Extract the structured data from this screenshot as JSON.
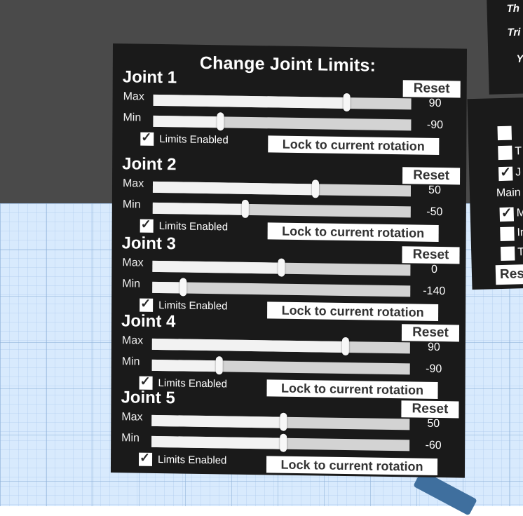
{
  "panel": {
    "title": "Change Joint Limits:",
    "reset_label": "Reset",
    "max_label": "Max",
    "min_label": "Min",
    "limits_label": "Limits Enabled",
    "lock_label": "Lock to current rotation"
  },
  "joints": [
    {
      "name": "Joint 1",
      "max": "90",
      "min": "-90",
      "max_pos": 0.75,
      "min_pos": 0.26,
      "enabled": true
    },
    {
      "name": "Joint 2",
      "max": "50",
      "min": "-50",
      "max_pos": 0.63,
      "min_pos": 0.36,
      "enabled": true
    },
    {
      "name": "Joint 3",
      "max": "0",
      "min": "-140",
      "max_pos": 0.5,
      "min_pos": 0.12,
      "enabled": true
    },
    {
      "name": "Joint 4",
      "max": "90",
      "min": "-90",
      "max_pos": 0.75,
      "min_pos": 0.26,
      "enabled": true
    },
    {
      "name": "Joint 5",
      "max": "50",
      "min": "-60",
      "max_pos": 0.51,
      "min_pos": 0.51,
      "enabled": true
    }
  ],
  "side_top": {
    "lines": [
      "Th",
      "Tri",
      "Y"
    ]
  },
  "side_bottom": {
    "items": [
      {
        "text": "",
        "checked": false
      },
      {
        "text": "T",
        "checked": false
      },
      {
        "text": "J",
        "checked": true
      }
    ],
    "section": "Main",
    "items2": [
      {
        "text": "M",
        "checked": true
      },
      {
        "text": "In",
        "checked": false
      },
      {
        "text": "Te",
        "checked": false
      }
    ],
    "button": "Res"
  },
  "colors": {
    "panel_bg": "#1a1a1a",
    "floor": "#d8eafd",
    "sky": "#4a4a4a"
  }
}
